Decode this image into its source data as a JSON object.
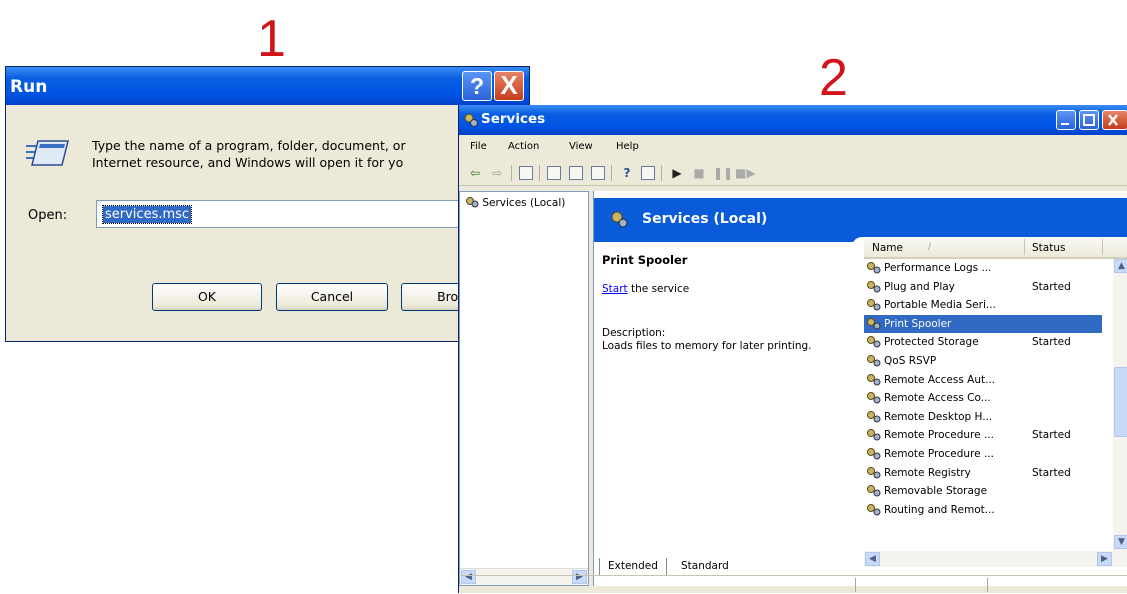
{
  "step_labels": [
    "1",
    "2"
  ],
  "run_dialog": {
    "title": "Run",
    "help_btn": "?",
    "close_btn": "X",
    "prompt_line1": "Type the name of a program, folder, document, or",
    "prompt_line2": "Internet resource, and Windows will open it for yo",
    "open_label": "Open:",
    "input_value": "services.msc",
    "ok_label": "OK",
    "cancel_label": "Cancel",
    "browse_label": "Brows"
  },
  "services_window": {
    "title": "Services",
    "menu": [
      "File",
      "Action",
      "View",
      "Help"
    ],
    "tree_item": "Services (Local)",
    "header_title": "Services (Local)",
    "selected_service": "Print Spooler",
    "start_link": "Start",
    "start_suffix": " the service",
    "description_label": "Description:",
    "description_text": "Loads files to memory for later printing.",
    "columns": {
      "name": "Name",
      "status": "Status"
    },
    "rows": [
      {
        "name": "Performance Logs ...",
        "status": ""
      },
      {
        "name": "Plug and Play",
        "status": "Started"
      },
      {
        "name": "Portable Media Seri...",
        "status": ""
      },
      {
        "name": "Print Spooler",
        "status": "",
        "selected": true
      },
      {
        "name": "Protected Storage",
        "status": "Started"
      },
      {
        "name": "QoS RSVP",
        "status": ""
      },
      {
        "name": "Remote Access Aut...",
        "status": ""
      },
      {
        "name": "Remote Access Co...",
        "status": ""
      },
      {
        "name": "Remote Desktop H...",
        "status": ""
      },
      {
        "name": "Remote Procedure ...",
        "status": "Started"
      },
      {
        "name": "Remote Procedure ...",
        "status": ""
      },
      {
        "name": "Remote Registry",
        "status": "Started"
      },
      {
        "name": "Removable Storage",
        "status": ""
      },
      {
        "name": "Routing and Remot...",
        "status": ""
      }
    ],
    "tabs": [
      "Extended",
      "Standard"
    ]
  },
  "colors": {
    "titlebar": "#0054e3",
    "selection": "#316ac5",
    "step_red": "#d2141a",
    "dialog_bg": "#ece9d8"
  }
}
